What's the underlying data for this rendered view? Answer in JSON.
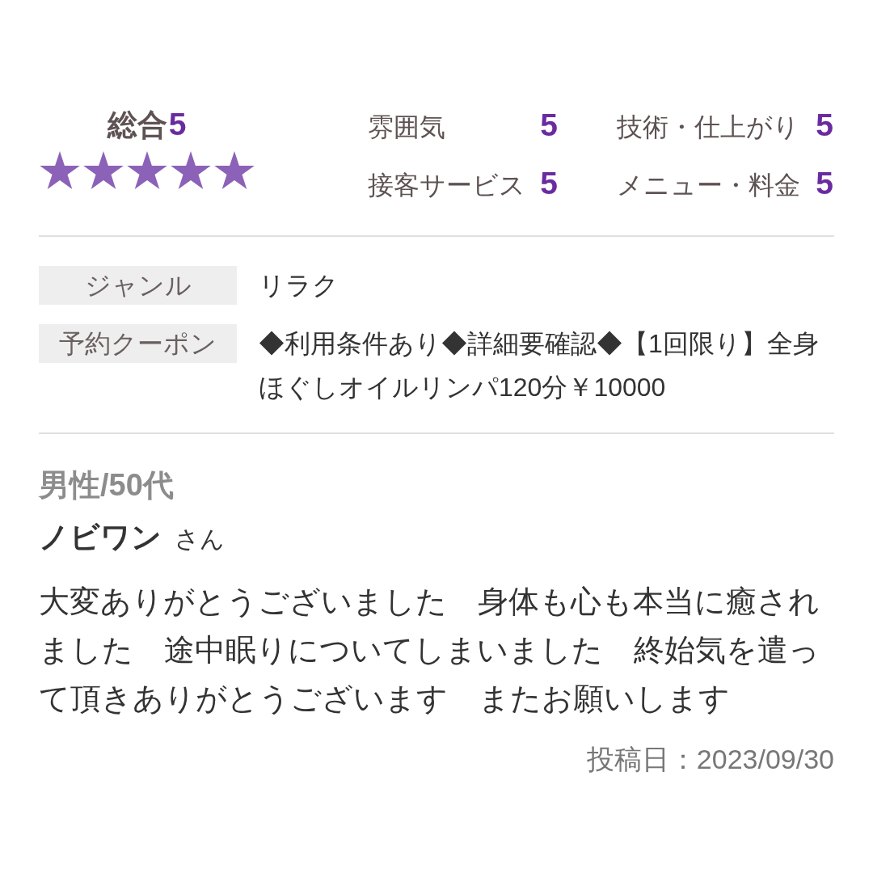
{
  "overall": {
    "label": "総合",
    "score": "5",
    "stars": 5
  },
  "categories": [
    {
      "label": "雰囲気",
      "score": "5"
    },
    {
      "label": "技術・仕上がり",
      "score": "5"
    },
    {
      "label": "接客サービス",
      "score": "5"
    },
    {
      "label": "メニュー・料金",
      "score": "5"
    }
  ],
  "details": [
    {
      "label": "ジャンル",
      "value": "リラク"
    },
    {
      "label": "予約クーポン",
      "value": "◆利用条件あり◆詳細要確認◆【1回限り】全身ほぐしオイルリンパ120分￥10000"
    }
  ],
  "review": {
    "reviewer_profile": "男性/50代",
    "reviewer_name": "ノビワン",
    "honorific": "さん",
    "comment": "大変ありがとうございました　身体も心も本当に癒されました　途中眠りについてしまいました　終始気を遣って頂きありがとうございます　またお願いします",
    "posted_date": "投稿日：2023/09/30"
  }
}
